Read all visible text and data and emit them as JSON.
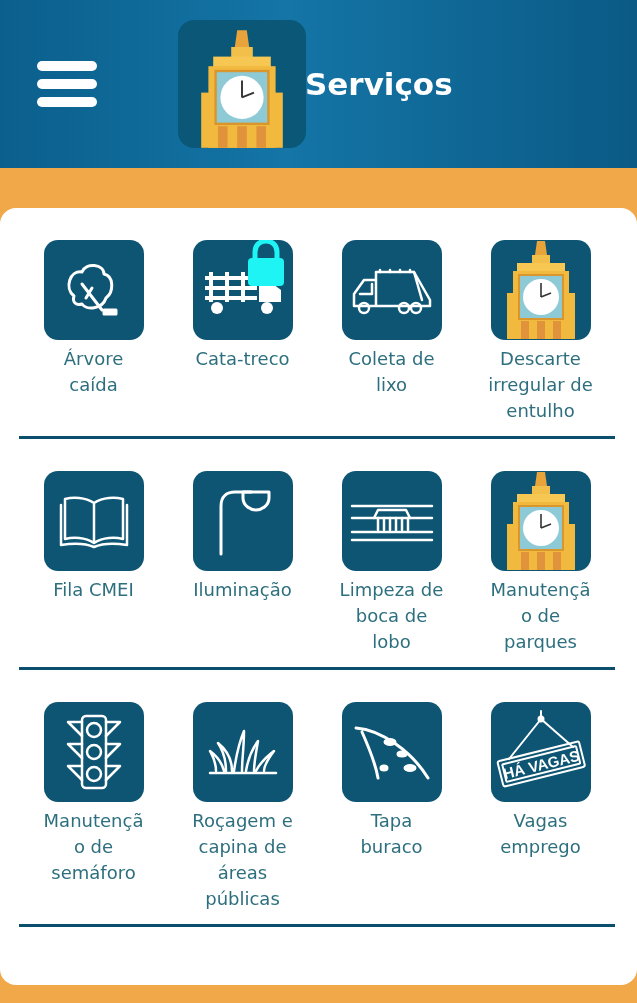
{
  "header": {
    "title": "Serviços"
  },
  "sections": [
    {
      "items": [
        {
          "label": "Árvore caída",
          "kind": "tree",
          "locked": false
        },
        {
          "label": "Cata-treco",
          "kind": "truck",
          "locked": true
        },
        {
          "label": "Coleta de lixo",
          "kind": "garbage",
          "locked": false
        },
        {
          "label": "Descarte irregular de entulho",
          "kind": "tower",
          "locked": false
        }
      ]
    },
    {
      "items": [
        {
          "label": "Fila CMEI",
          "kind": "book",
          "locked": false
        },
        {
          "label": "Iluminação",
          "kind": "lamp",
          "locked": false
        },
        {
          "label": "Limpeza de boca de lobo",
          "kind": "drain",
          "locked": false
        },
        {
          "label": "Manutenção de parques",
          "kind": "tower",
          "locked": false
        }
      ]
    },
    {
      "items": [
        {
          "label": "Manutenção de semáforo",
          "kind": "semaphore",
          "locked": false
        },
        {
          "label": "Roçagem e capina de áreas públicas",
          "kind": "grass",
          "locked": false
        },
        {
          "label": "Tapa buraco",
          "kind": "pothole",
          "locked": false
        },
        {
          "label": "Vagas emprego",
          "kind": "sign",
          "locked": false,
          "sign_text": "HÁ VAGAS"
        }
      ]
    }
  ]
}
